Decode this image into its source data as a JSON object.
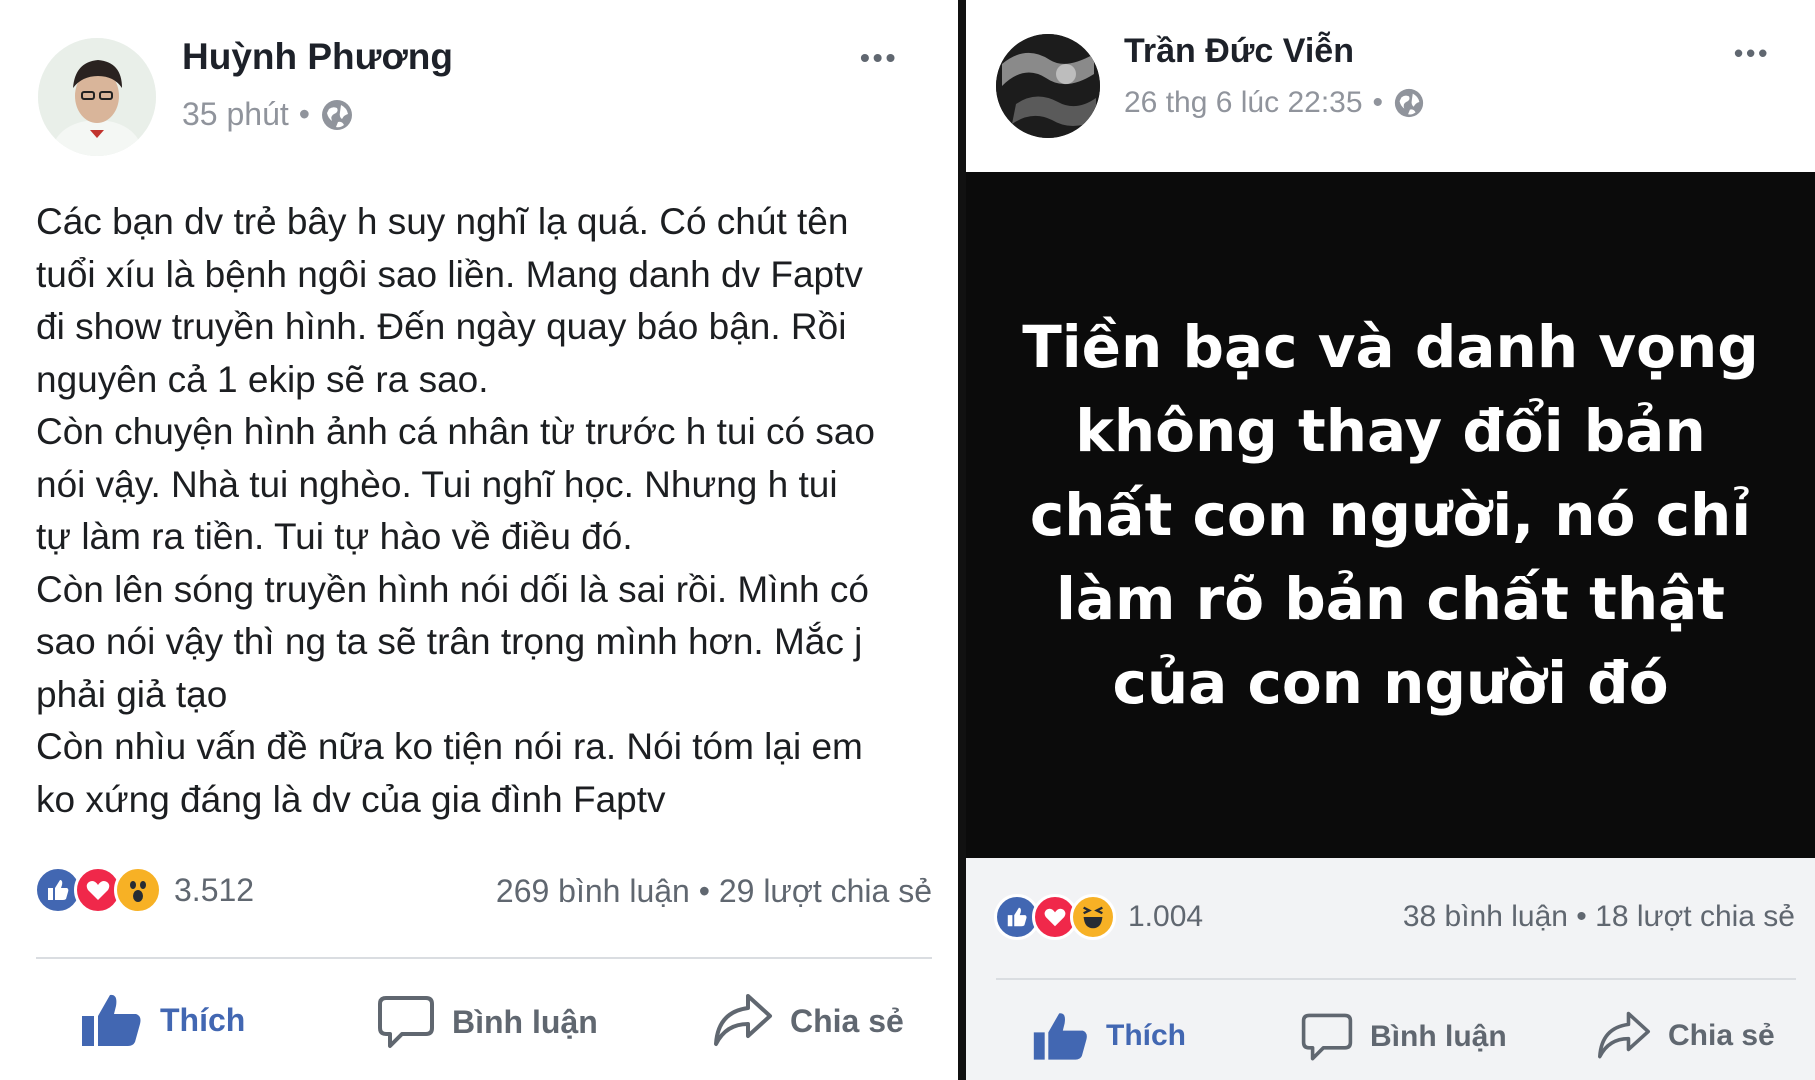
{
  "colors": {
    "like_blue": "#4267b2",
    "love_red": "#f0284a",
    "wow_yellow": "#f7b125",
    "meta_gray": "#90949c",
    "divider": "#111111",
    "quote_background": "#0b0b0b"
  },
  "left_post": {
    "author": "Huỳnh Phương",
    "time": "35 phút",
    "separator": "•",
    "privacy_icon": "globe-icon",
    "more_label": "•••",
    "body": "Các bạn dv trẻ bây h suy nghĩ lạ quá. Có chút tên\ntuổi xíu là bệnh ngôi sao liền. Mang danh dv Faptv\nđi show truyền hình. Đến ngày quay báo bận.  Rồi\nnguyên cả 1 ekip sẽ ra sao.\nCòn chuyện hình ảnh cá nhân từ trước h tui có sao\nnói vậy. Nhà tui nghèo. Tui nghĩ học. Nhưng h tui\ntự làm ra tiền. Tui tự hào về điều đó.\nCòn lên sóng truyền hình nói dối là sai rồi. Mình có\nsao nói vậy thì ng ta sẽ trân trọng mình hơn. Mắc j\nphải giả tạo\nCòn nhìu vấn đề nữa ko tiện nói ra. Nói tóm lại em\nko xứng đáng là dv của gia đình Faptv",
    "reactions": [
      "like-icon",
      "love-icon",
      "wow-icon"
    ],
    "reaction_count": "3.512",
    "stats": "269 bình luận • 29 lượt chia sẻ",
    "actions": {
      "like": "Thích",
      "comment": "Bình luận",
      "share": "Chia sẻ"
    }
  },
  "right_post": {
    "author": "Trần Đức Viễn",
    "time": "26 thg 6 lúc 22:35",
    "separator": "•",
    "privacy_icon": "globe-icon",
    "more_label": "•••",
    "quote": "Tiền bạc và danh vọng\nkhông thay đổi bản\nchất con người, nó chỉ\nlàm rõ bản chất thật\ncủa con người đó",
    "reactions": [
      "like-icon",
      "love-icon",
      "haha-icon"
    ],
    "reaction_count": "1.004",
    "stats": "38 bình luận • 18 lượt chia sẻ",
    "actions": {
      "like": "Thích",
      "comment": "Bình luận",
      "share": "Chia sẻ"
    }
  }
}
